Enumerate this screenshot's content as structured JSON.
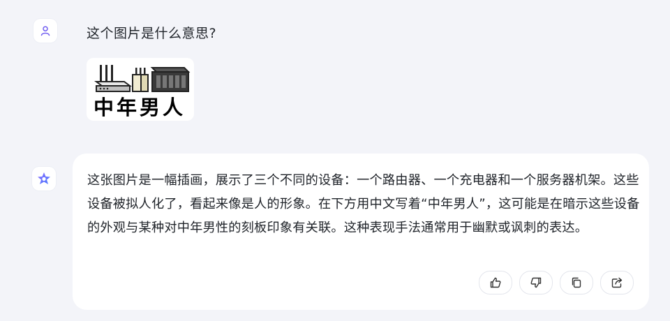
{
  "user_message": {
    "text": "这个图片是什么意思?",
    "image": {
      "caption": "中年男人"
    }
  },
  "assistant_message": {
    "text": "这张图片是一幅插画，展示了三个不同的设备：一个路由器、一个充电器和一个服务器机架。这些设备被拟人化了，看起来像是人的形象。在下方用中文写着“中年男人”，这可能是在暗示这些设备的外观与某种对中年男性的刻板印象有关联。这种表现手法通常用于幽默或讽刺的表达。"
  },
  "actions": [
    {
      "icon": "thumbs-up-icon"
    },
    {
      "icon": "thumbs-down-icon"
    },
    {
      "icon": "copy-icon"
    },
    {
      "icon": "share-icon"
    }
  ],
  "colors": {
    "background": "#f3f4f9",
    "accent": "#6f5cf0"
  }
}
